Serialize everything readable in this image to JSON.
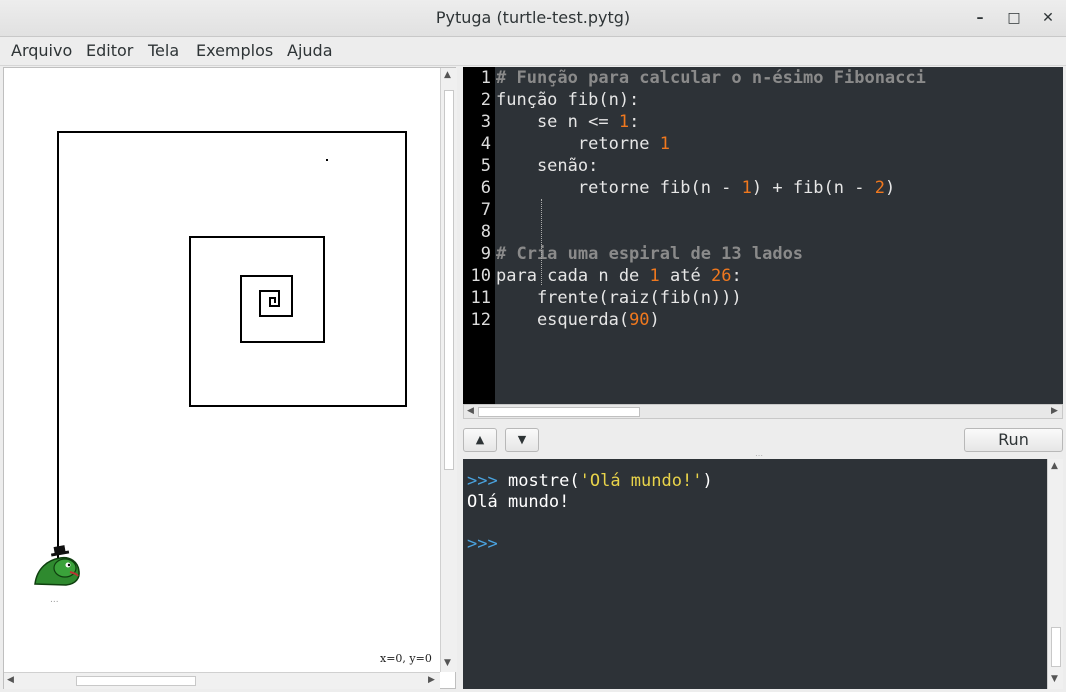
{
  "window": {
    "title": "Pytuga (turtle-test.pytg)"
  },
  "window_controls": {
    "minimize": "–",
    "maximize": "□",
    "close": "✕"
  },
  "menu": [
    "Arquivo",
    "Editor",
    "Tela",
    "Exemplos",
    "Ajuda"
  ],
  "canvas": {
    "coords": "x=0, y=0",
    "turtle_trail": "..."
  },
  "editor": {
    "lines": [
      {
        "n": "1",
        "segs": [
          {
            "t": "# Função para calcular o n-ésimo Fibonacci",
            "c": "cmt"
          }
        ]
      },
      {
        "n": "2",
        "segs": [
          {
            "t": "função fib(n):",
            "c": ""
          }
        ]
      },
      {
        "n": "3",
        "segs": [
          {
            "t": "    se n <= ",
            "c": ""
          },
          {
            "t": "1",
            "c": "num"
          },
          {
            "t": ":",
            "c": ""
          }
        ]
      },
      {
        "n": "4",
        "segs": [
          {
            "t": "        retorne ",
            "c": ""
          },
          {
            "t": "1",
            "c": "num"
          }
        ]
      },
      {
        "n": "5",
        "segs": [
          {
            "t": "    senão:",
            "c": ""
          }
        ]
      },
      {
        "n": "6",
        "segs": [
          {
            "t": "        retorne fib(n - ",
            "c": ""
          },
          {
            "t": "1",
            "c": "num"
          },
          {
            "t": ") + fib(n - ",
            "c": ""
          },
          {
            "t": "2",
            "c": "num"
          },
          {
            "t": ")",
            "c": ""
          }
        ]
      },
      {
        "n": "7",
        "segs": []
      },
      {
        "n": "8",
        "segs": []
      },
      {
        "n": "9",
        "segs": [
          {
            "t": "# Cria uma espiral de 13 lados",
            "c": "cmt"
          }
        ]
      },
      {
        "n": "10",
        "segs": [
          {
            "t": "para cada n de ",
            "c": ""
          },
          {
            "t": "1",
            "c": "num"
          },
          {
            "t": " até ",
            "c": ""
          },
          {
            "t": "26",
            "c": "num"
          },
          {
            "t": ":",
            "c": ""
          }
        ]
      },
      {
        "n": "11",
        "segs": [
          {
            "t": "    frente(raiz(fib(n)))",
            "c": ""
          }
        ]
      },
      {
        "n": "12",
        "segs": [
          {
            "t": "    esquerda(",
            "c": ""
          },
          {
            "t": "90",
            "c": "num"
          },
          {
            "t": ")",
            "c": ""
          }
        ]
      }
    ]
  },
  "controls": {
    "up": "▲",
    "down": "▼",
    "run": "Run"
  },
  "console": {
    "prompt": ">>>",
    "command_prefix": "mostre(",
    "command_string": "'Olá mundo!'",
    "command_suffix": ")",
    "output": "Olá mundo!"
  },
  "colors": {
    "editor_bg": "#2d3237",
    "number": "#f0781e",
    "comment": "#8a8a8a",
    "prompt": "#4aa3df",
    "string": "#e8d34a"
  }
}
